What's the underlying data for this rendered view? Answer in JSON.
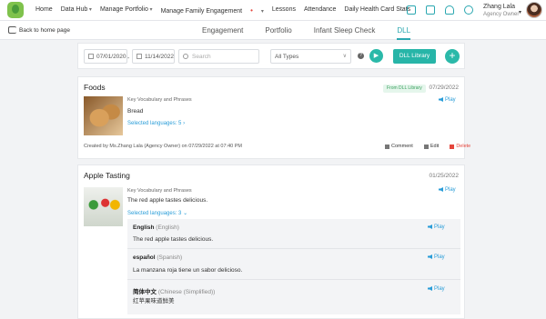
{
  "nav": {
    "items": [
      "Home",
      "Data Hub",
      "Manage Portfolio",
      "Manage Family Engagement",
      "Lessons",
      "Attendance",
      "Daily Health Card Stats"
    ],
    "dropdown_items": [
      1,
      2,
      3
    ],
    "red_dot_item": 3
  },
  "top_icons": [
    "school-icon",
    "graduation-cap-icon",
    "bell-icon",
    "gear-icon"
  ],
  "user": {
    "name": "Zhang Lala",
    "role": "Agency Owner"
  },
  "subbar": {
    "back_label": "Back to home page",
    "tabs": [
      "Engagement",
      "Portfolio",
      "Infant Sleep Check",
      "DLL"
    ],
    "active_tab": 3
  },
  "filters": {
    "start_date": "07/01/2020",
    "date_separator": "-",
    "end_date": "11/14/2022",
    "search_placeholder": "Search",
    "type_value": "All Types",
    "help_label": "?",
    "play_label": "▶",
    "dll_library_label": "DLL Library",
    "add_label": "+"
  },
  "cards": [
    {
      "title": "Foods",
      "badge": "From DLL Library",
      "date": "07/29/2022",
      "section_label": "Key Vocabulary and Phrases",
      "content": "Bread",
      "play_label": "Play",
      "selected_languages": "Selected languages: 5",
      "created_by": "Created by Ms.Zhang Lala (Agency Owner) on 07/29/2022 at 07:40 PM",
      "actions": {
        "comment": "Comment",
        "edit": "Edit",
        "delete": "Delete"
      }
    },
    {
      "title": "Apple Tasting",
      "date": "01/25/2022",
      "section_label": "Key Vocabulary and Phrases",
      "content": "The red apple tastes delicious.",
      "play_label": "Play",
      "selected_languages": "Selected languages: 3",
      "languages": [
        {
          "name": "English",
          "sub": "(English)",
          "text": "The red apple tastes delicious.",
          "play": "Play"
        },
        {
          "name": "español",
          "sub": "(Spanish)",
          "text": "La manzana roja tiene un sabor delicioso.",
          "play": "Play"
        },
        {
          "name": "简体中文",
          "sub": "(Chinese (Simplified))",
          "text": "红苹果味道鲜美",
          "play": "Play"
        }
      ]
    }
  ],
  "colors": {
    "accent": "#2bb9a9",
    "link": "#2a9dd8",
    "delete": "#e5463c",
    "badge_bg": "#e5f6ec",
    "badge_text": "#3aa05e"
  }
}
